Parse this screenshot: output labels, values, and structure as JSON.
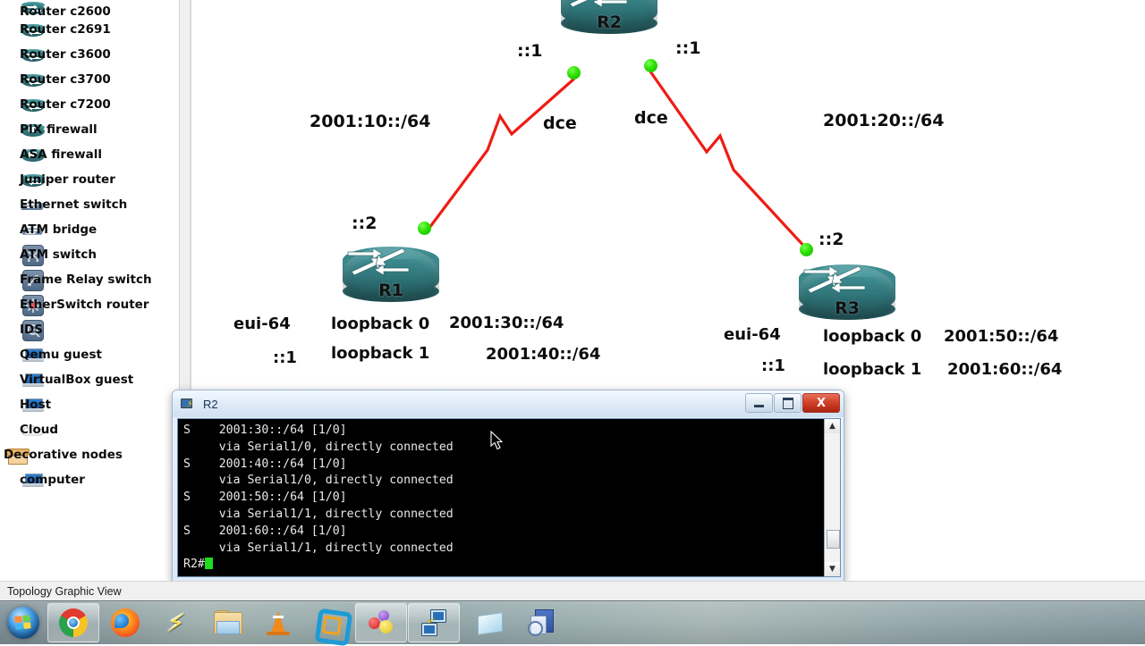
{
  "app": {
    "statusbar_text": "Topology Graphic View"
  },
  "sidebar": {
    "items": [
      {
        "label": "Router c2600",
        "icon": "router-icon",
        "partial": true
      },
      {
        "label": "Router c2691",
        "icon": "router-icon"
      },
      {
        "label": "Router c3600",
        "icon": "router-icon"
      },
      {
        "label": "Router c3700",
        "icon": "router-icon"
      },
      {
        "label": "Router c7200",
        "icon": "router-icon"
      },
      {
        "label": "PIX firewall",
        "icon": "firewall-icon"
      },
      {
        "label": "ASA firewall",
        "icon": "firewall-icon"
      },
      {
        "label": "Juniper router",
        "icon": "router-icon"
      },
      {
        "label": "Ethernet switch",
        "icon": "switch-icon"
      },
      {
        "label": "ATM bridge",
        "icon": "bridge-icon"
      },
      {
        "label": "ATM switch",
        "icon": "atm-switch-icon"
      },
      {
        "label": "Frame Relay switch",
        "icon": "frame-relay-icon"
      },
      {
        "label": "EtherSwitch router",
        "icon": "etherswitch-icon"
      },
      {
        "label": "IDS",
        "icon": "ids-icon"
      },
      {
        "label": "Qemu guest",
        "icon": "computer-icon"
      },
      {
        "label": "VirtualBox guest",
        "icon": "computer-icon"
      },
      {
        "label": "Host",
        "icon": "computer-icon"
      },
      {
        "label": "Cloud",
        "icon": "cloud-icon"
      }
    ],
    "category": {
      "label": "Decorative nodes",
      "icon": "box-icon"
    },
    "category_items": [
      {
        "label": "computer",
        "icon": "computer-icon"
      }
    ]
  },
  "topology": {
    "routers": [
      {
        "id": "r2",
        "name": "R2"
      },
      {
        "id": "r1",
        "name": "R1"
      },
      {
        "id": "r3",
        "name": "R3"
      }
    ],
    "link_labels": {
      "left_network": "2001:10::/64",
      "right_network": "2001:20::/64",
      "r2_left_iface": "::1",
      "r2_right_iface": "::1",
      "r2_left_dce": "dce",
      "r2_right_dce": "dce",
      "r1_iface": "::2",
      "r3_iface": "::2"
    },
    "r1_block": {
      "eui": "eui-64",
      "eui_addr": "::1",
      "loopback0": "loopback 0",
      "loopback0_net": "2001:30::/64",
      "loopback1": "loopback 1",
      "loopback1_net": "2001:40::/64"
    },
    "r3_block": {
      "eui": "eui-64",
      "eui_addr": "::1",
      "loopback0": "loopback 0",
      "loopback0_net": "2001:50::/64",
      "loopback1": "loopback 1",
      "loopback1_net": "2001:60::/64"
    },
    "colors": {
      "link": "#ee1c14",
      "node_up": "#2ee000",
      "router_body": "#3d8b8f"
    }
  },
  "terminal": {
    "title": "R2",
    "icon": "console-icon",
    "buttons": {
      "minimize": "minimize",
      "maximize": "maximize",
      "close": "X"
    },
    "lines": [
      "S    2001:30::/64 [1/0]",
      "     via Serial1/0, directly connected",
      "S    2001:40::/64 [1/0]",
      "     via Serial1/0, directly connected",
      "S    2001:50::/64 [1/0]",
      "     via Serial1/1, directly connected",
      "S    2001:60::/64 [1/0]",
      "     via Serial1/1, directly connected"
    ],
    "prompt": "R2#",
    "scroll_up": "▲",
    "scroll_down": "▼"
  },
  "taskbar": {
    "items": [
      {
        "name": "start-button",
        "icon": "windows-orb-icon",
        "label": "Start"
      },
      {
        "name": "chrome",
        "icon": "chrome-icon",
        "label": "Google Chrome"
      },
      {
        "name": "firefox",
        "icon": "firefox-icon",
        "label": "Mozilla Firefox"
      },
      {
        "name": "winamp",
        "icon": "winamp-icon",
        "label": "Winamp"
      },
      {
        "name": "explorer",
        "icon": "folder-icon",
        "label": "Windows Explorer"
      },
      {
        "name": "vlc",
        "icon": "vlc-cone-icon",
        "label": "VLC media player"
      },
      {
        "name": "vmware",
        "icon": "vmware-icon",
        "label": "VMware"
      },
      {
        "name": "gns3",
        "icon": "gns3-icon",
        "label": "GNS3"
      },
      {
        "name": "console",
        "icon": "console-network-icon",
        "label": "R2 Console"
      },
      {
        "name": "paper",
        "icon": "paper-icon",
        "label": "Document"
      },
      {
        "name": "docsearch",
        "icon": "document-search-icon",
        "label": "Document Search"
      }
    ]
  }
}
